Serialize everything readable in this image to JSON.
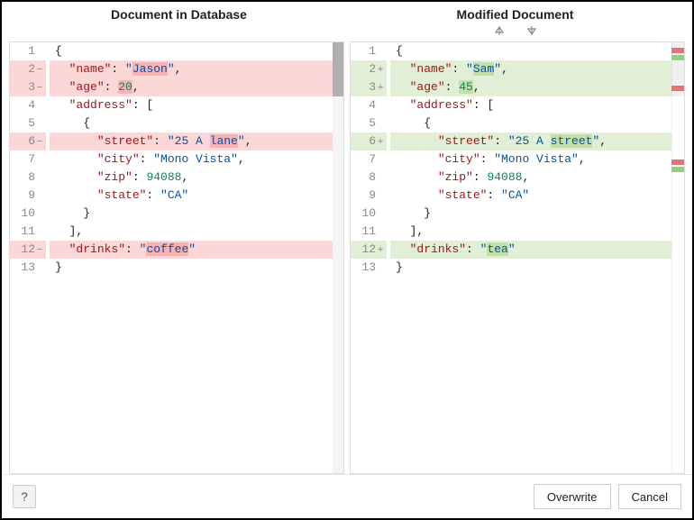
{
  "headers": {
    "left_title": "Document in Database",
    "right_title": "Modified Document"
  },
  "nav": {
    "prev_icon": "arrow-up-icon",
    "next_icon": "arrow-down-icon"
  },
  "left": {
    "lines": [
      {
        "n": 1,
        "diff": "",
        "tokens": [
          [
            "p",
            "{"
          ]
        ]
      },
      {
        "n": 2,
        "diff": "del",
        "tokens": [
          [
            "p",
            "  "
          ],
          [
            "k",
            "\"name\""
          ],
          [
            "p",
            ": "
          ],
          [
            "s",
            "\""
          ],
          [
            "sd",
            "Jason"
          ],
          [
            "s",
            "\""
          ],
          [
            "p",
            ","
          ]
        ]
      },
      {
        "n": 3,
        "diff": "del",
        "tokens": [
          [
            "p",
            "  "
          ],
          [
            "k",
            "\"age\""
          ],
          [
            "p",
            ": "
          ],
          [
            "nd",
            "20"
          ],
          [
            "p",
            ","
          ]
        ]
      },
      {
        "n": 4,
        "diff": "",
        "tokens": [
          [
            "p",
            "  "
          ],
          [
            "k",
            "\"address\""
          ],
          [
            "p",
            ": ["
          ]
        ]
      },
      {
        "n": 5,
        "diff": "",
        "tokens": [
          [
            "p",
            "    {"
          ]
        ]
      },
      {
        "n": 6,
        "diff": "del",
        "tokens": [
          [
            "p",
            "      "
          ],
          [
            "k",
            "\"street\""
          ],
          [
            "p",
            ": "
          ],
          [
            "s",
            "\"25 A "
          ],
          [
            "sd",
            "lane"
          ],
          [
            "s",
            "\""
          ],
          [
            "p",
            ","
          ]
        ]
      },
      {
        "n": 7,
        "diff": "",
        "tokens": [
          [
            "p",
            "      "
          ],
          [
            "k",
            "\"city\""
          ],
          [
            "p",
            ": "
          ],
          [
            "s",
            "\"Mono Vista\""
          ],
          [
            "p",
            ","
          ]
        ]
      },
      {
        "n": 8,
        "diff": "",
        "tokens": [
          [
            "p",
            "      "
          ],
          [
            "k",
            "\"zip\""
          ],
          [
            "p",
            ": "
          ],
          [
            "n",
            "94088"
          ],
          [
            "p",
            ","
          ]
        ]
      },
      {
        "n": 9,
        "diff": "",
        "tokens": [
          [
            "p",
            "      "
          ],
          [
            "k",
            "\"state\""
          ],
          [
            "p",
            ": "
          ],
          [
            "s",
            "\"CA\""
          ]
        ]
      },
      {
        "n": 10,
        "diff": "",
        "tokens": [
          [
            "p",
            "    }"
          ]
        ]
      },
      {
        "n": 11,
        "diff": "",
        "tokens": [
          [
            "p",
            "  ],"
          ]
        ]
      },
      {
        "n": 12,
        "diff": "del",
        "tokens": [
          [
            "p",
            "  "
          ],
          [
            "k",
            "\"drinks\""
          ],
          [
            "p",
            ": "
          ],
          [
            "s",
            "\""
          ],
          [
            "sd",
            "coffee"
          ],
          [
            "s",
            "\""
          ]
        ]
      },
      {
        "n": 13,
        "diff": "",
        "tokens": [
          [
            "p",
            "}"
          ]
        ]
      }
    ],
    "mark_minus": "−"
  },
  "right": {
    "lines": [
      {
        "n": 1,
        "diff": "",
        "tokens": [
          [
            "p",
            "{"
          ]
        ]
      },
      {
        "n": 2,
        "diff": "add",
        "tokens": [
          [
            "p",
            "  "
          ],
          [
            "k",
            "\"name\""
          ],
          [
            "p",
            ": "
          ],
          [
            "s",
            "\""
          ],
          [
            "sa",
            "Sam"
          ],
          [
            "s",
            "\""
          ],
          [
            "p",
            ","
          ]
        ]
      },
      {
        "n": 3,
        "diff": "add",
        "tokens": [
          [
            "p",
            "  "
          ],
          [
            "k",
            "\"age\""
          ],
          [
            "p",
            ": "
          ],
          [
            "na",
            "45"
          ],
          [
            "p",
            ","
          ]
        ]
      },
      {
        "n": 4,
        "diff": "",
        "tokens": [
          [
            "p",
            "  "
          ],
          [
            "k",
            "\"address\""
          ],
          [
            "p",
            ": ["
          ]
        ]
      },
      {
        "n": 5,
        "diff": "",
        "tokens": [
          [
            "p",
            "    {"
          ]
        ]
      },
      {
        "n": 6,
        "diff": "add",
        "tokens": [
          [
            "p",
            "      "
          ],
          [
            "k",
            "\"street\""
          ],
          [
            "p",
            ": "
          ],
          [
            "s",
            "\"25 A "
          ],
          [
            "sa",
            "street"
          ],
          [
            "s",
            "\""
          ],
          [
            "p",
            ","
          ]
        ]
      },
      {
        "n": 7,
        "diff": "",
        "tokens": [
          [
            "p",
            "      "
          ],
          [
            "k",
            "\"city\""
          ],
          [
            "p",
            ": "
          ],
          [
            "s",
            "\"Mono Vista\""
          ],
          [
            "p",
            ","
          ]
        ]
      },
      {
        "n": 8,
        "diff": "",
        "tokens": [
          [
            "p",
            "      "
          ],
          [
            "k",
            "\"zip\""
          ],
          [
            "p",
            ": "
          ],
          [
            "n",
            "94088"
          ],
          [
            "p",
            ","
          ]
        ]
      },
      {
        "n": 9,
        "diff": "",
        "tokens": [
          [
            "p",
            "      "
          ],
          [
            "k",
            "\"state\""
          ],
          [
            "p",
            ": "
          ],
          [
            "s",
            "\"CA\""
          ]
        ]
      },
      {
        "n": 10,
        "diff": "",
        "tokens": [
          [
            "p",
            "    }"
          ]
        ]
      },
      {
        "n": 11,
        "diff": "",
        "tokens": [
          [
            "p",
            "  ],"
          ]
        ]
      },
      {
        "n": 12,
        "diff": "add",
        "tokens": [
          [
            "p",
            "  "
          ],
          [
            "k",
            "\"drinks\""
          ],
          [
            "p",
            ": "
          ],
          [
            "s",
            "\""
          ],
          [
            "sa",
            "tea"
          ],
          [
            "s",
            "\""
          ]
        ]
      },
      {
        "n": 13,
        "diff": "",
        "tokens": [
          [
            "p",
            "}"
          ]
        ]
      }
    ],
    "mark_plus": "+"
  },
  "footer": {
    "help_glyph": "?",
    "overwrite_label": "Overwrite",
    "cancel_label": "Cancel"
  },
  "colors": {
    "key": "#a31515",
    "string": "#0451a5",
    "number": "#098658",
    "del_bg": "#fcd7d7",
    "add_bg": "#e2efd7"
  }
}
